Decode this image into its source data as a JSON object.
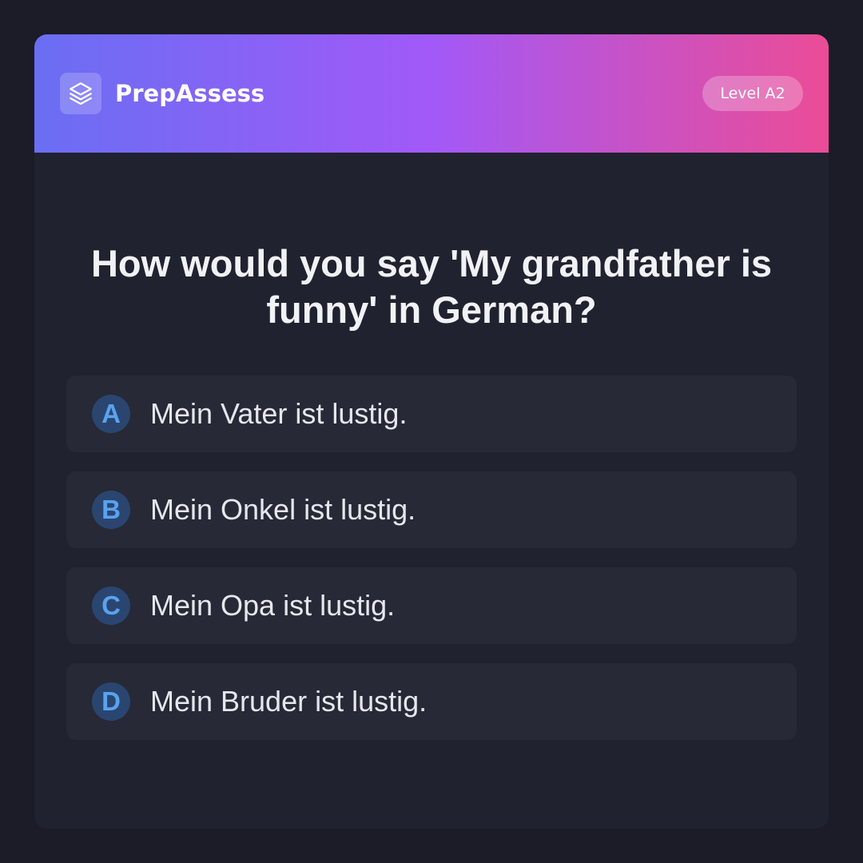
{
  "header": {
    "brand": "PrepAssess",
    "logo_icon": "layers-icon",
    "level": "Level A2"
  },
  "question": "How would you say 'My grandfather is funny' in German?",
  "options": [
    {
      "letter": "A",
      "text": "Mein Vater ist lustig."
    },
    {
      "letter": "B",
      "text": "Mein Onkel ist lustig."
    },
    {
      "letter": "C",
      "text": "Mein Opa ist lustig."
    },
    {
      "letter": "D",
      "text": "Mein Bruder ist lustig."
    }
  ],
  "colors": {
    "background": "#1b1c27",
    "card": "#20222f",
    "option_bg": "#272936",
    "gradient_start": "#6a6ef3",
    "gradient_mid": "#a259f7",
    "gradient_end": "#eb4c96",
    "letter_circle": "#2a4670",
    "letter_text": "#5aa2ee"
  }
}
